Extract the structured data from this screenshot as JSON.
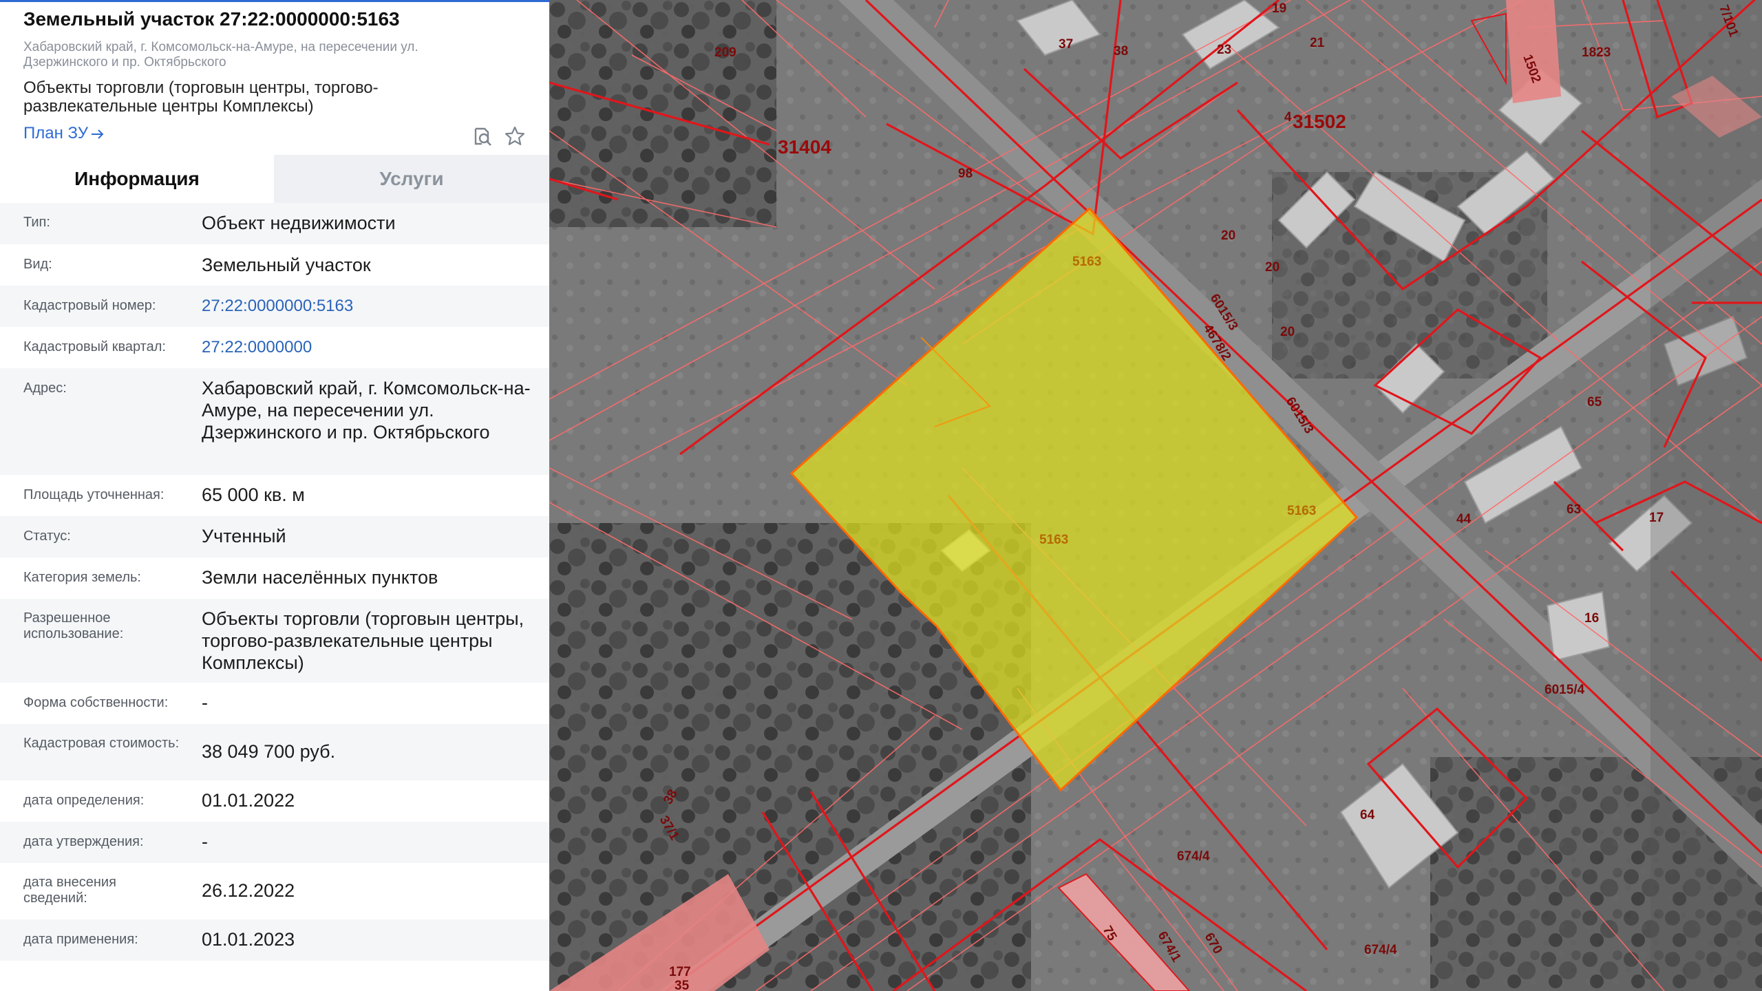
{
  "parcel": {
    "title": "Земельный участок 27:22:0000000:5163",
    "address_short": "Хабаровский край, г. Комсомольск-на-Амуре, на пересечении ул. Дзержинского и пр. Октябрьского",
    "purpose": "Объекты торговли (торговын центры, торгово-развлекательные центры Комплексы)",
    "plan_link": "План ЗУ"
  },
  "tabs": [
    {
      "label": "Информация",
      "active": true
    },
    {
      "label": "Услуги",
      "active": false
    }
  ],
  "info": [
    {
      "label": "Тип:",
      "value": "Объект недвижимости"
    },
    {
      "label": "Вид:",
      "value": "Земельный участок"
    },
    {
      "label": "Кадастровый номер:",
      "value": "27:22:0000000:5163",
      "link": true
    },
    {
      "label": "Кадастровый квартал:",
      "value": "27:22:0000000",
      "link": true
    },
    {
      "label": "Адрес:",
      "value": "Хабаровский край, г. Комсомольск-на-Амуре, на пересечении ул. Дзержинского и пр. Октябрьского"
    },
    {
      "label": "Площадь уточненная:",
      "value": "65 000 кв. м"
    },
    {
      "label": "Статус:",
      "value": "Учтенный"
    },
    {
      "label": "Категория земель:",
      "value": "Земли населённых пунктов"
    },
    {
      "label": "Разрешенное использование:",
      "value": "Объекты торговли (торговын центры, торгово-развлекательные центры Комплексы)"
    },
    {
      "label": "Форма собственности:",
      "value": "-"
    },
    {
      "label": "Кадастровая стоимость:",
      "value": "38 049 700 руб."
    },
    {
      "label": "дата определения:",
      "value": "01.01.2022"
    },
    {
      "label": "дата утверждения:",
      "value": "-"
    },
    {
      "label": "дата внесения сведений:",
      "value": "26.12.2022"
    },
    {
      "label": "дата применения:",
      "value": "01.01.2023"
    }
  ],
  "map": {
    "highlight_color": "#e2e21e",
    "boundary_color": "#e0161b",
    "labels": {
      "l209": "209",
      "l37": "37",
      "l38": "38",
      "l19": "19",
      "l23": "23",
      "l21": "21",
      "l1502": "1502",
      "l1823": "1823",
      "l7101": "7/101",
      "l31502": "31502",
      "l4": "4",
      "l31404": "31404",
      "l98": "98",
      "l20a": "20",
      "l20b": "20",
      "l20c": "20",
      "l6015_3a": "6015/3",
      "l4678_2": "4678/2",
      "l6015_3b": "6015/3",
      "l5163a": "5163",
      "l5163b": "5163",
      "l5163c": "5163",
      "l65": "65",
      "l44": "44",
      "l63": "63",
      "l17": "17",
      "l16": "16",
      "l6015_4": "6015/4",
      "l64": "64",
      "l674_4a": "674/4",
      "l674_4b": "674/4",
      "l674_1": "674/1",
      "l670": "670",
      "l75": "75",
      "l38b": "38",
      "l37_1": "37/1",
      "l177": "177",
      "l35": "35"
    }
  }
}
